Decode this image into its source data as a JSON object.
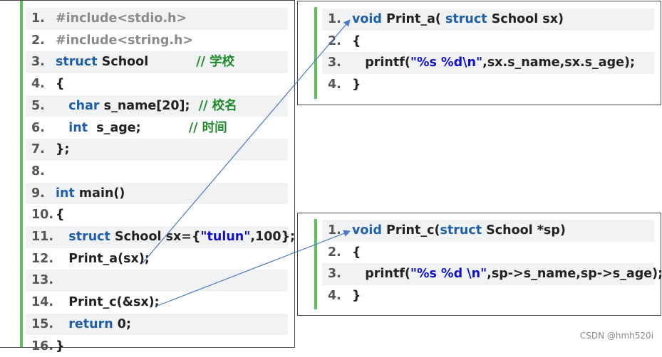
{
  "left_code": {
    "lines": [
      {
        "num": "1.",
        "tokens": [
          {
            "text": "#include<stdio.h>",
            "cls": "inc"
          }
        ]
      },
      {
        "num": "2.",
        "tokens": [
          {
            "text": "#include<string.h>",
            "cls": "inc"
          }
        ]
      },
      {
        "num": "3.",
        "tokens": [
          {
            "text": "struct",
            "cls": "kw"
          },
          {
            "text": " School           ",
            "cls": ""
          },
          {
            "text": "// 学校",
            "cls": "cm"
          }
        ]
      },
      {
        "num": "4.",
        "tokens": [
          {
            "text": "{",
            "cls": ""
          }
        ]
      },
      {
        "num": "5.",
        "tokens": [
          {
            "text": "   ",
            "cls": ""
          },
          {
            "text": "char",
            "cls": "kw"
          },
          {
            "text": " s_name[20];  ",
            "cls": ""
          },
          {
            "text": "// 校名",
            "cls": "cm"
          }
        ]
      },
      {
        "num": "6.",
        "tokens": [
          {
            "text": "   ",
            "cls": ""
          },
          {
            "text": "int",
            "cls": "kw"
          },
          {
            "text": "  s_age;           ",
            "cls": ""
          },
          {
            "text": "// 时间",
            "cls": "cm"
          }
        ]
      },
      {
        "num": "7.",
        "tokens": [
          {
            "text": "};",
            "cls": ""
          }
        ]
      },
      {
        "num": "8.",
        "tokens": []
      },
      {
        "num": "9.",
        "tokens": [
          {
            "text": "int",
            "cls": "kw"
          },
          {
            "text": " main()",
            "cls": ""
          }
        ]
      },
      {
        "num": "10.",
        "tokens": [
          {
            "text": "{",
            "cls": ""
          }
        ]
      },
      {
        "num": "11.",
        "tokens": [
          {
            "text": "   ",
            "cls": ""
          },
          {
            "text": "struct",
            "cls": "kw"
          },
          {
            "text": " School sx={",
            "cls": ""
          },
          {
            "text": "\"tulun\"",
            "cls": "str"
          },
          {
            "text": ",100};",
            "cls": ""
          }
        ]
      },
      {
        "num": "12.",
        "tokens": [
          {
            "text": "   Print_a(sx);",
            "cls": ""
          }
        ]
      },
      {
        "num": "13.",
        "tokens": []
      },
      {
        "num": "14.",
        "tokens": [
          {
            "text": "   Print_c(&sx);",
            "cls": ""
          }
        ]
      },
      {
        "num": "15.",
        "tokens": [
          {
            "text": "   ",
            "cls": ""
          },
          {
            "text": "return",
            "cls": "kw"
          },
          {
            "text": " 0;",
            "cls": ""
          }
        ]
      },
      {
        "num": "16.",
        "tokens": [
          {
            "text": "}",
            "cls": ""
          }
        ]
      }
    ]
  },
  "print_a_code": {
    "lines": [
      {
        "num": "1.",
        "tokens": [
          {
            "text": "void",
            "cls": "kw"
          },
          {
            "text": " Print_a( ",
            "cls": ""
          },
          {
            "text": "struct",
            "cls": "kw"
          },
          {
            "text": " School sx)",
            "cls": ""
          }
        ]
      },
      {
        "num": "2.",
        "tokens": [
          {
            "text": "{",
            "cls": ""
          }
        ]
      },
      {
        "num": "3.",
        "tokens": [
          {
            "text": "   printf(",
            "cls": ""
          },
          {
            "text": "\"%s %d",
            "cls": "str"
          },
          {
            "text": "\\n",
            "cls": "esc"
          },
          {
            "text": "\"",
            "cls": "str"
          },
          {
            "text": ",sx.s_name,sx.s_age);",
            "cls": ""
          }
        ]
      },
      {
        "num": "4.",
        "tokens": [
          {
            "text": "}",
            "cls": ""
          }
        ]
      }
    ]
  },
  "print_c_code": {
    "lines": [
      {
        "num": "1.",
        "tokens": [
          {
            "text": "void",
            "cls": "kw"
          },
          {
            "text": " Print_c(",
            "cls": ""
          },
          {
            "text": "struct",
            "cls": "kw"
          },
          {
            "text": " School *sp)",
            "cls": ""
          }
        ]
      },
      {
        "num": "2.",
        "tokens": [
          {
            "text": "{",
            "cls": ""
          }
        ]
      },
      {
        "num": "3.",
        "tokens": [
          {
            "text": "   printf(",
            "cls": ""
          },
          {
            "text": "\"%s %d ",
            "cls": "str"
          },
          {
            "text": "\\n",
            "cls": "esc"
          },
          {
            "text": "\"",
            "cls": "str"
          },
          {
            "text": ",sp->s_name,sp->s_age);",
            "cls": ""
          }
        ]
      },
      {
        "num": "4.",
        "tokens": [
          {
            "text": "}",
            "cls": ""
          }
        ]
      }
    ]
  },
  "watermark": "CSDN @hmh520i",
  "colors": {
    "keyword": "#1e5fa8",
    "comment": "#1f8a2a",
    "string": "#1010cc",
    "gutter": "#5cc05c",
    "arrow": "#4a78c8"
  }
}
